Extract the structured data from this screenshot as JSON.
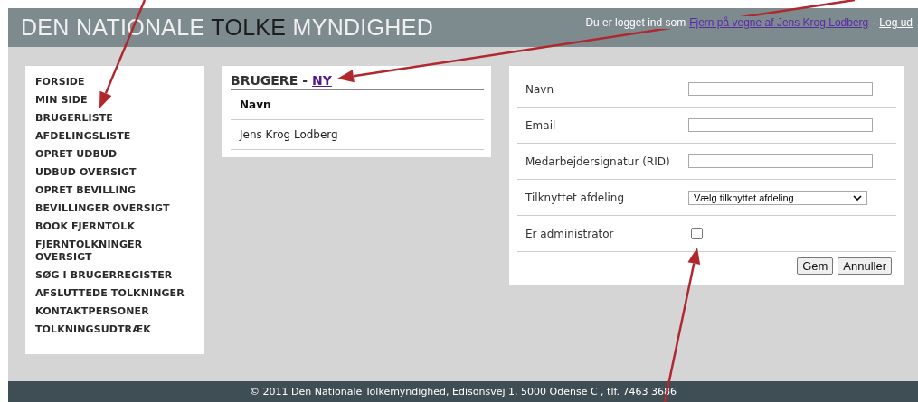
{
  "header": {
    "logo": [
      {
        "text": "DEN NATIONALE ",
        "highlight": false
      },
      {
        "text": "TOLKE",
        "highlight": true
      },
      {
        "text": " MYNDIGHED",
        "highlight": false
      }
    ],
    "login_text": "Du er logget ind som",
    "user_link": "Fjern på vegne af Jens Krog Lodberg",
    "separator": "-",
    "logout_link": "Log ud"
  },
  "sidebar": {
    "items": [
      "FORSIDE",
      "MIN SIDE",
      "BRUGERLISTE",
      "AFDELINGSLISTE",
      "OPRET UDBUD",
      "UDBUD OVERSIGT",
      "OPRET BEVILLING",
      "BEVILLINGER OVERSIGT",
      "BOOK FJERNTOLK",
      "FJERNTOLKNINGER OVERSIGT",
      "SØG I BRUGERREGISTER",
      "AFSLUTTEDE TOLKNINGER",
      "KONTAKTPERSONER",
      "TOLKNINGSUDTRÆK"
    ]
  },
  "users_panel": {
    "title": "BRUGERE",
    "separator": "-",
    "new_link": "NY",
    "columns": [
      "Navn"
    ],
    "rows": [
      [
        "Jens Krog Lodberg"
      ]
    ]
  },
  "form": {
    "fields": [
      {
        "kind": "text",
        "label": "Navn"
      },
      {
        "kind": "text",
        "label": "Email"
      },
      {
        "kind": "text",
        "label": "Medarbejdersignatur (RID)"
      },
      {
        "kind": "select",
        "label": "Tilknyttet afdeling",
        "value": "Vælg tilknyttet afdeling"
      },
      {
        "kind": "checkbox",
        "label": "Er administrator",
        "checked": false
      }
    ],
    "buttons": [
      "Gem",
      "Annuller"
    ]
  },
  "footer": "© 2011 Den Nationale Tolkemyndighed, Edisonsvej 1, 5000 Odense C , tlf. 7463 3686"
}
